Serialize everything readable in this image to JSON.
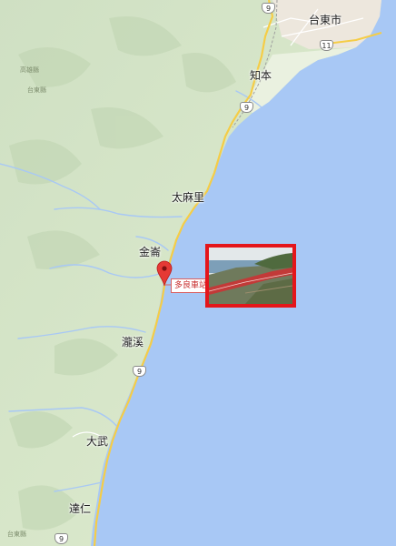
{
  "map": {
    "places": {
      "taitung_city": "台東市",
      "zhiben": "知本",
      "taimali": "太麻里",
      "jinlun": "金崙",
      "duoliang_station": "多良車站",
      "longxi": "瀧溪",
      "dawu": "大武",
      "daren": "達仁"
    },
    "routes": {
      "r9_north": "9",
      "r11": "11",
      "r9_zhiben": "9",
      "r9_south": "9",
      "r9_bottom": "9"
    },
    "minor_labels": {
      "a": "高雄縣",
      "b": "台東縣",
      "c": "台東縣"
    },
    "colors": {
      "sea": "#a8c8f5",
      "land": "#d9e8cf",
      "road_major": "#f5cd47",
      "river": "#a8c8f5",
      "marker": "#e53935",
      "photo_frame": "#e4161b"
    },
    "icons": {
      "marker": "map-pin-icon",
      "photo": "station-photo"
    }
  }
}
